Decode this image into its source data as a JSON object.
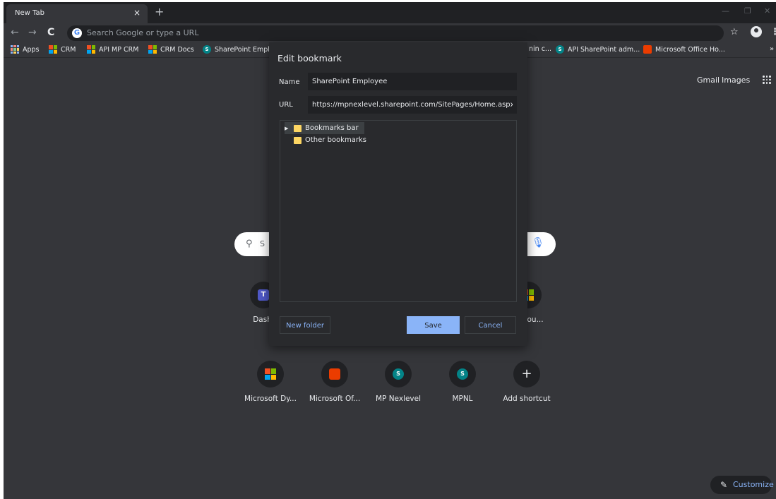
{
  "tab": {
    "title": "New Tab",
    "close": "×",
    "new": "+"
  },
  "window_controls": {
    "minimize": "—",
    "restore": "❐",
    "close": "✕"
  },
  "toolbar": {
    "back": "←",
    "forward": "→",
    "reload": "C",
    "omnibox_placeholder": "Search Google or type a URL",
    "star": "☆",
    "menu": "⋮"
  },
  "bookmarks": {
    "apps": "Apps",
    "crm": "CRM",
    "api_mp_crm": "API MP CRM",
    "crm_docs": "CRM Docs",
    "sharepoint_empl": "SharePoint Empl",
    "admin_c": "nin c...",
    "api_sharepoint": "API SharePoint adm...",
    "office_home": "Microsoft Office Ho...",
    "more": "»"
  },
  "ntp": {
    "gmail": "Gmail",
    "images": "Images",
    "search_letter": "S",
    "shortcuts_row1": [
      {
        "label": "Dashl",
        "icon": "teams-icon"
      },
      {
        "label": "to you...",
        "icon": "microsoft-icon"
      }
    ],
    "shortcuts_row2": [
      {
        "label": "Microsoft Dy...",
        "icon": "microsoft-icon"
      },
      {
        "label": "Microsoft Of...",
        "icon": "office-icon"
      },
      {
        "label": "MP Nexlevel",
        "icon": "sharepoint-icon"
      },
      {
        "label": "MPNL",
        "icon": "sharepoint-icon"
      },
      {
        "label": "Add shortcut",
        "icon": "plus-icon"
      }
    ],
    "customize": "Customize"
  },
  "dialog": {
    "title": "Edit bookmark",
    "name_label": "Name",
    "name_value": "SharePoint Employee",
    "url_label": "URL",
    "url_value": "https://mpnexlevel.sharepoint.com/SitePages/Home.aspx",
    "folders": [
      "Bookmarks bar",
      "Other bookmarks"
    ],
    "new_folder": "New folder",
    "save": "Save",
    "cancel": "Cancel"
  },
  "colors": {
    "accent": "#8ab4f8",
    "frame": "#202124",
    "page": "#35363a",
    "dialog": "#292a2d"
  }
}
